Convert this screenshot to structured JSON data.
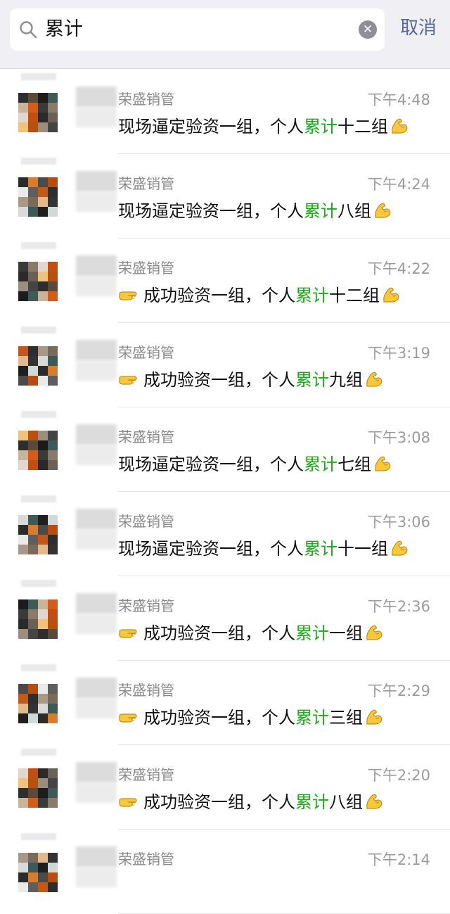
{
  "search": {
    "query": "累计",
    "cancel_label": "取消",
    "clear_icon": "clear-icon",
    "search_icon": "search-icon"
  },
  "colors": {
    "highlight": "#1aad19",
    "cancel": "#576b95",
    "time": "#9b9b9b",
    "topbar": "#efeff4"
  },
  "results": [
    {
      "sender": "荣盛销管",
      "time": "下午4:48",
      "prefix": "现场逼定验资一组，个人",
      "highlight": "累计",
      "suffix": "十二组",
      "lead_icon": "",
      "trail_icon": "flexed-biceps-icon"
    },
    {
      "sender": "荣盛销管",
      "time": "下午4:24",
      "prefix": "现场逼定验资一组，个人",
      "highlight": "累计",
      "suffix": "八组",
      "lead_icon": "",
      "trail_icon": "flexed-biceps-icon"
    },
    {
      "sender": "荣盛销管",
      "time": "下午4:22",
      "prefix": "成功验资一组，个人",
      "highlight": "累计",
      "suffix": "十二组",
      "lead_icon": "pointing-hand-icon",
      "trail_icon": "flexed-biceps-icon"
    },
    {
      "sender": "荣盛销管",
      "time": "下午3:19",
      "prefix": "成功验资一组，个人",
      "highlight": "累计",
      "suffix": "九组",
      "lead_icon": "pointing-hand-icon",
      "trail_icon": "flexed-biceps-icon"
    },
    {
      "sender": "荣盛销管",
      "time": "下午3:08",
      "prefix": "现场逼定验资一组，个人",
      "highlight": "累计",
      "suffix": "七组",
      "lead_icon": "",
      "trail_icon": "flexed-biceps-icon"
    },
    {
      "sender": "荣盛销管",
      "time": "下午3:06",
      "prefix": "现场逼定验资一组，个人",
      "highlight": "累计",
      "suffix": "十一组",
      "lead_icon": "",
      "trail_icon": "flexed-biceps-icon"
    },
    {
      "sender": "荣盛销管",
      "time": "下午2:36",
      "prefix": "成功验资一组，个人",
      "highlight": "累计",
      "suffix": "一组",
      "lead_icon": "pointing-hand-icon",
      "trail_icon": "flexed-biceps-icon"
    },
    {
      "sender": "荣盛销管",
      "time": "下午2:29",
      "prefix": "成功验资一组，个人",
      "highlight": "累计",
      "suffix": "三组",
      "lead_icon": "pointing-hand-icon",
      "trail_icon": "flexed-biceps-icon"
    },
    {
      "sender": "荣盛销管",
      "time": "下午2:20",
      "prefix": "成功验资一组，个人",
      "highlight": "累计",
      "suffix": "八组",
      "lead_icon": "pointing-hand-icon",
      "trail_icon": "flexed-biceps-icon"
    },
    {
      "sender": "荣盛销管",
      "time": "下午2:14",
      "prefix": "",
      "highlight": "",
      "suffix": "",
      "lead_icon": "",
      "trail_icon": ""
    }
  ]
}
